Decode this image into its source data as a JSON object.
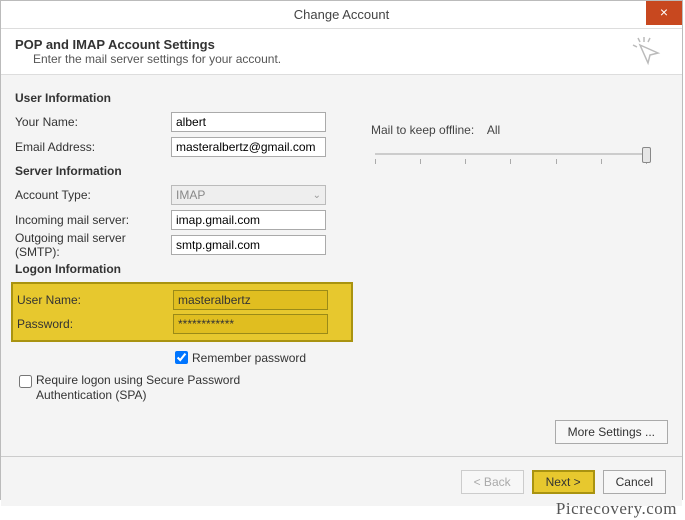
{
  "window": {
    "title": "Change Account",
    "close_label": "×"
  },
  "header": {
    "title": "POP and IMAP Account Settings",
    "subtitle": "Enter the mail server settings for your account."
  },
  "sections": {
    "user_info": "User Information",
    "server_info": "Server Information",
    "logon_info": "Logon Information"
  },
  "labels": {
    "your_name": "Your Name:",
    "email": "Email Address:",
    "account_type": "Account Type:",
    "incoming": "Incoming mail server:",
    "outgoing": "Outgoing mail server (SMTP):",
    "username": "User Name:",
    "password": "Password:",
    "remember": "Remember password",
    "spa": "Require logon using Secure Password Authentication (SPA)",
    "mail_keep": "Mail to keep offline:",
    "mail_keep_value": "All"
  },
  "values": {
    "your_name": "albert",
    "email": "masteralbertz@gmail.com",
    "account_type": "IMAP",
    "incoming": "imap.gmail.com",
    "outgoing": "smtp.gmail.com",
    "username": "masteralbertz",
    "password": "************",
    "remember_checked": true,
    "spa_checked": false
  },
  "buttons": {
    "more_settings": "More Settings ...",
    "back": "< Back",
    "next": "Next >",
    "cancel": "Cancel"
  },
  "watermark": "Picrecovery.com"
}
